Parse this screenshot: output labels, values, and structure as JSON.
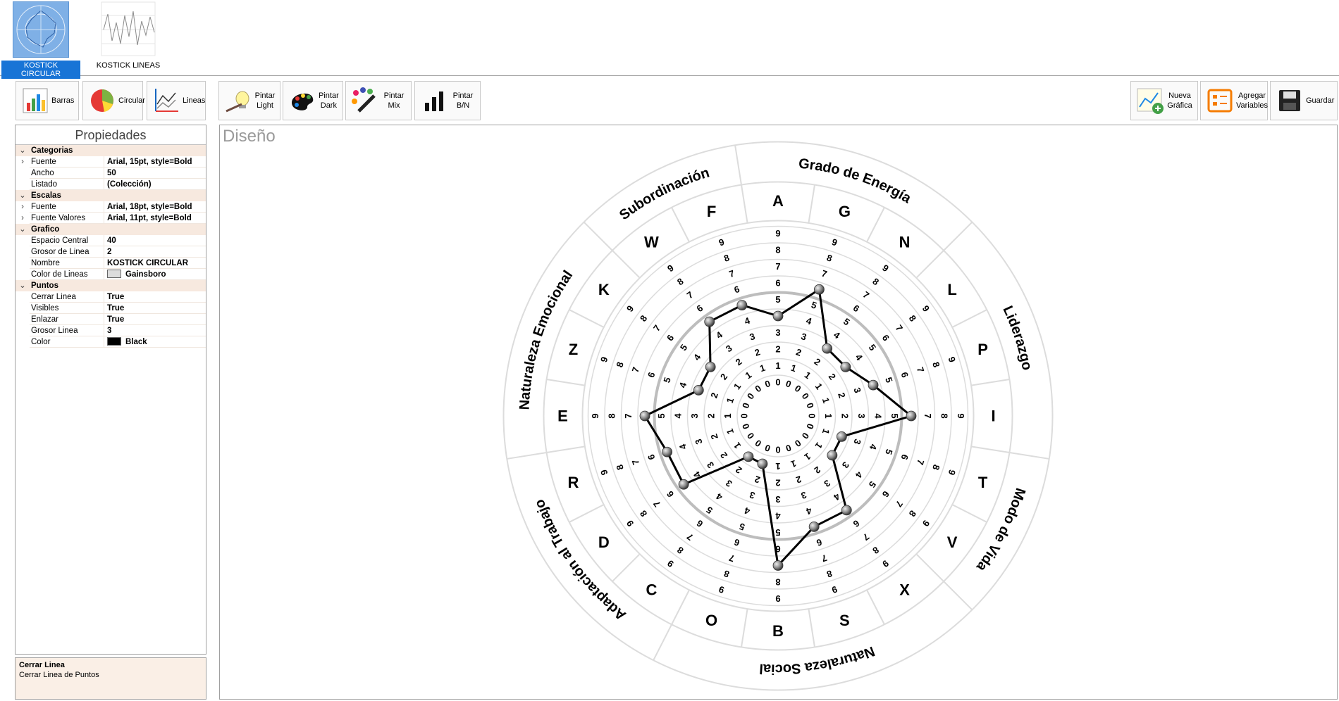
{
  "thumbnails": [
    {
      "label": "KOSTICK CIRCULAR",
      "selected": true
    },
    {
      "label": "KOSTICK LINEAS",
      "selected": false
    }
  ],
  "toolbar": {
    "barras": "Barras",
    "circular": "Circular",
    "lineas": "Lineas",
    "pintar_light": [
      "Pintar",
      "Light"
    ],
    "pintar_dark": [
      "Pintar",
      "Dark"
    ],
    "pintar_mix": [
      "Pintar",
      "Mix"
    ],
    "pintar_bn": [
      "Pintar",
      "B/N"
    ],
    "nueva_grafica": [
      "Nueva",
      "Gráfica"
    ],
    "agregar_variables": [
      "Agregar",
      "Variables"
    ],
    "guardar": "Guardar"
  },
  "properties": {
    "title": "Propiedades",
    "categorias": {
      "label": "Categorias",
      "fuente_k": "Fuente",
      "fuente_v": "Arial, 15pt, style=Bold",
      "ancho_k": "Ancho",
      "ancho_v": "50",
      "listado_k": "Listado",
      "listado_v": "(Colección)"
    },
    "escalas": {
      "label": "Escalas",
      "fuente_k": "Fuente",
      "fuente_v": "Arial, 18pt, style=Bold",
      "fuente_valores_k": "Fuente Valores",
      "fuente_valores_v": "Arial, 11pt, style=Bold"
    },
    "grafico": {
      "label": "Grafico",
      "espacio_k": "Espacio Central",
      "espacio_v": "40",
      "grosor_k": "Grosor de Linea",
      "grosor_v": "2",
      "nombre_k": "Nombre",
      "nombre_v": "KOSTICK CIRCULAR",
      "color_k": "Color de Lineas",
      "color_v": "Gainsboro",
      "color_hex": "#DCDCDC"
    },
    "puntos": {
      "label": "Puntos",
      "cerrar_k": "Cerrar Linea",
      "cerrar_v": "True",
      "visibles_k": "Visibles",
      "visibles_v": "True",
      "enlazar_k": "Enlazar",
      "enlazar_v": "True",
      "grosor_k": "Grosor Linea",
      "grosor_v": "3",
      "color_k": "Color",
      "color_v": "Black",
      "color_hex": "#000000"
    }
  },
  "help": {
    "title": "Cerrar Linea",
    "text": "Cerrar Linea de Puntos"
  },
  "design": {
    "title": "Diseño"
  },
  "chart_data": {
    "type": "radar",
    "title": "",
    "categories": [
      "A",
      "G",
      "N",
      "L",
      "P",
      "I",
      "T",
      "V",
      "X",
      "S",
      "B",
      "O",
      "C",
      "D",
      "R",
      "E",
      "Z",
      "K",
      "W",
      "F"
    ],
    "scale_ticks": [
      0,
      1,
      2,
      3,
      4,
      5,
      6,
      7,
      8,
      9
    ],
    "groups": [
      {
        "name": "Grado de Energía",
        "categories": [
          "A",
          "G",
          "N"
        ]
      },
      {
        "name": "Liderazgo",
        "categories": [
          "L",
          "P",
          "I"
        ]
      },
      {
        "name": "Modo de Vida",
        "categories": [
          "T",
          "V"
        ]
      },
      {
        "name": "Naturaleza Social",
        "categories": [
          "X",
          "S",
          "B",
          "O"
        ]
      },
      {
        "name": "Adaptación al Trabajo",
        "categories": [
          "C",
          "D",
          "R"
        ]
      },
      {
        "name": "Naturaleza Emocional",
        "categories": [
          "E",
          "Z",
          "K"
        ]
      },
      {
        "name": "Subordinación",
        "categories": [
          "W",
          "F"
        ]
      }
    ],
    "series": [
      {
        "values": [
          4,
          6,
          3,
          3,
          4,
          6,
          2,
          2,
          5,
          5,
          7,
          1,
          1,
          5,
          5,
          6,
          3,
          3,
          5,
          5
        ]
      }
    ],
    "line_color": "#000000",
    "grid_color": "#DCDCDC",
    "highlight_ring": 5
  }
}
